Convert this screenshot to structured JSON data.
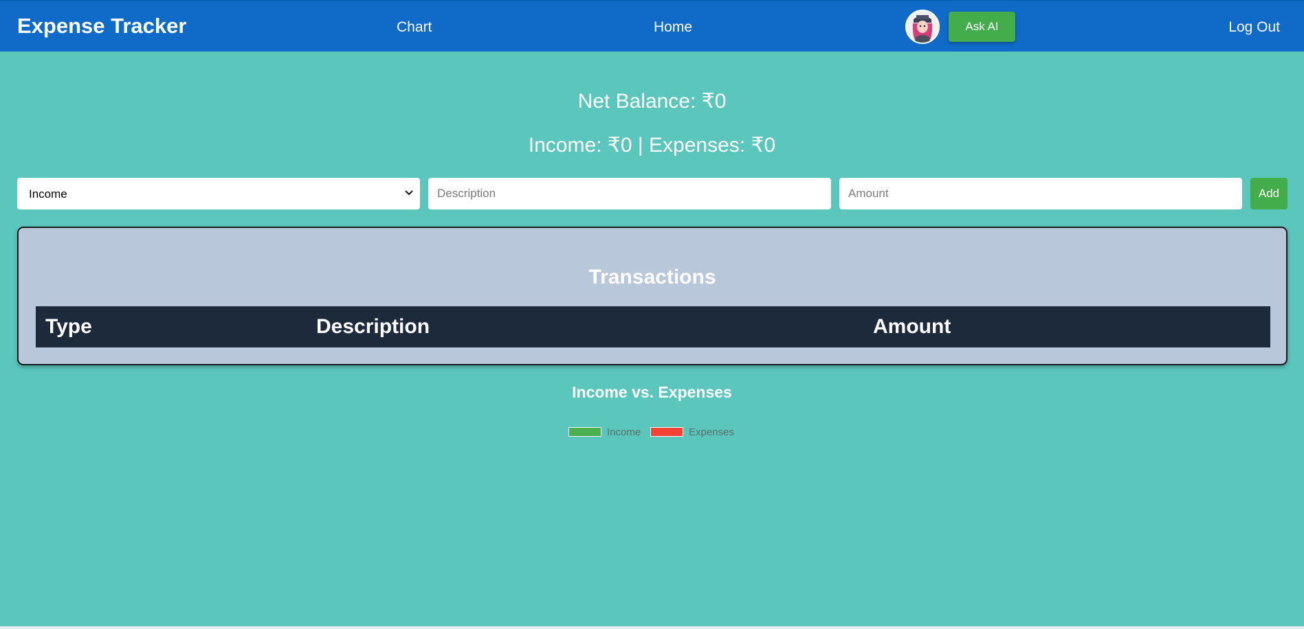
{
  "navbar": {
    "brand": "Expense Tracker",
    "links": {
      "chart": "Chart",
      "home": "Home",
      "logout": "Log Out"
    },
    "ask_ai_label": "Ask AI",
    "color": "#106bc8"
  },
  "summary": {
    "net_balance": "Net Balance: ₹0",
    "income_expenses": "Income: ₹0 | Expenses: ₹0"
  },
  "form": {
    "type_select": {
      "selected": "Income"
    },
    "description": {
      "placeholder": "Description",
      "value": ""
    },
    "amount": {
      "placeholder": "Amount",
      "value": ""
    },
    "add_label": "Add"
  },
  "transactions": {
    "title": "Transactions",
    "columns": [
      "Type",
      "Description",
      "Amount"
    ],
    "rows": []
  },
  "chart": {
    "title": "Income vs. Expenses",
    "legend": [
      {
        "label": "Income",
        "color": "#4caf50"
      },
      {
        "label": "Expenses",
        "color": "#f44336"
      }
    ]
  },
  "colors": {
    "background": "#5bc6bc",
    "accent_green": "#43ad4b",
    "table_header": "#1c2a3b",
    "panel": "#b8c8da"
  },
  "icons": {
    "avatar": "user-avatar",
    "select_chevron": "chevron-down-icon"
  }
}
